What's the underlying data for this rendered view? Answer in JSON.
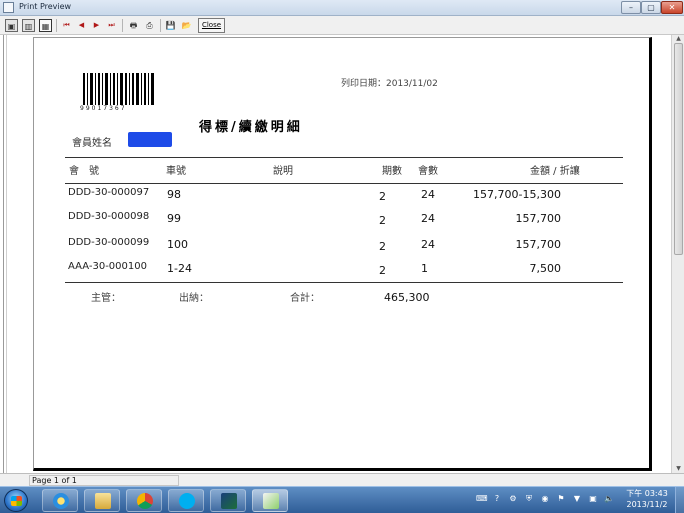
{
  "window": {
    "title": "Print Preview",
    "min_label": "–",
    "max_label": "▢",
    "close_label": "✕"
  },
  "toolbar": {
    "close_label": "Close",
    "nav": {
      "first": "⏮",
      "prev": "◀",
      "next": "▶",
      "last": "⏭"
    }
  },
  "report": {
    "barcode_digits": "99017367",
    "print_date": "列印日期：2013/11/02",
    "title": "得標/續繳明細",
    "member_label": "會員姓名",
    "columns": {
      "member_no": "會　號",
      "car_no": "車號",
      "desc": "說明",
      "periods": "期數",
      "count": "會數",
      "amount": "金額 / 折讓"
    },
    "rows": [
      {
        "member_no": "DDD-30-000097",
        "car_no": "98",
        "desc": "",
        "periods": "2",
        "count": "24",
        "amount": "157,700-15,300"
      },
      {
        "member_no": "DDD-30-000098",
        "car_no": "99",
        "desc": "",
        "periods": "2",
        "count": "24",
        "amount": "157,700"
      },
      {
        "member_no": "DDD-30-000099",
        "car_no": "100",
        "desc": "",
        "periods": "2",
        "count": "24",
        "amount": "157,700"
      },
      {
        "member_no": "AAA-30-000100",
        "car_no": "1-24",
        "desc": "",
        "periods": "2",
        "count": "1",
        "amount": "7,500"
      }
    ],
    "footer": {
      "supervisor": "主管：",
      "cashier": "出納：",
      "total_label": "合計：",
      "total_value": "465,300"
    }
  },
  "statusbar": {
    "page_indicator": "Page 1 of 1"
  },
  "taskbar": {
    "clock_period": "下午 03:43",
    "clock_date": "2013/11/2",
    "apps": [
      "internet-explorer",
      "file-explorer",
      "chrome",
      "skype",
      "vim",
      "paint"
    ]
  },
  "colors": {
    "redaction": "#1e4be8",
    "taskbar": "#2f5d97"
  }
}
